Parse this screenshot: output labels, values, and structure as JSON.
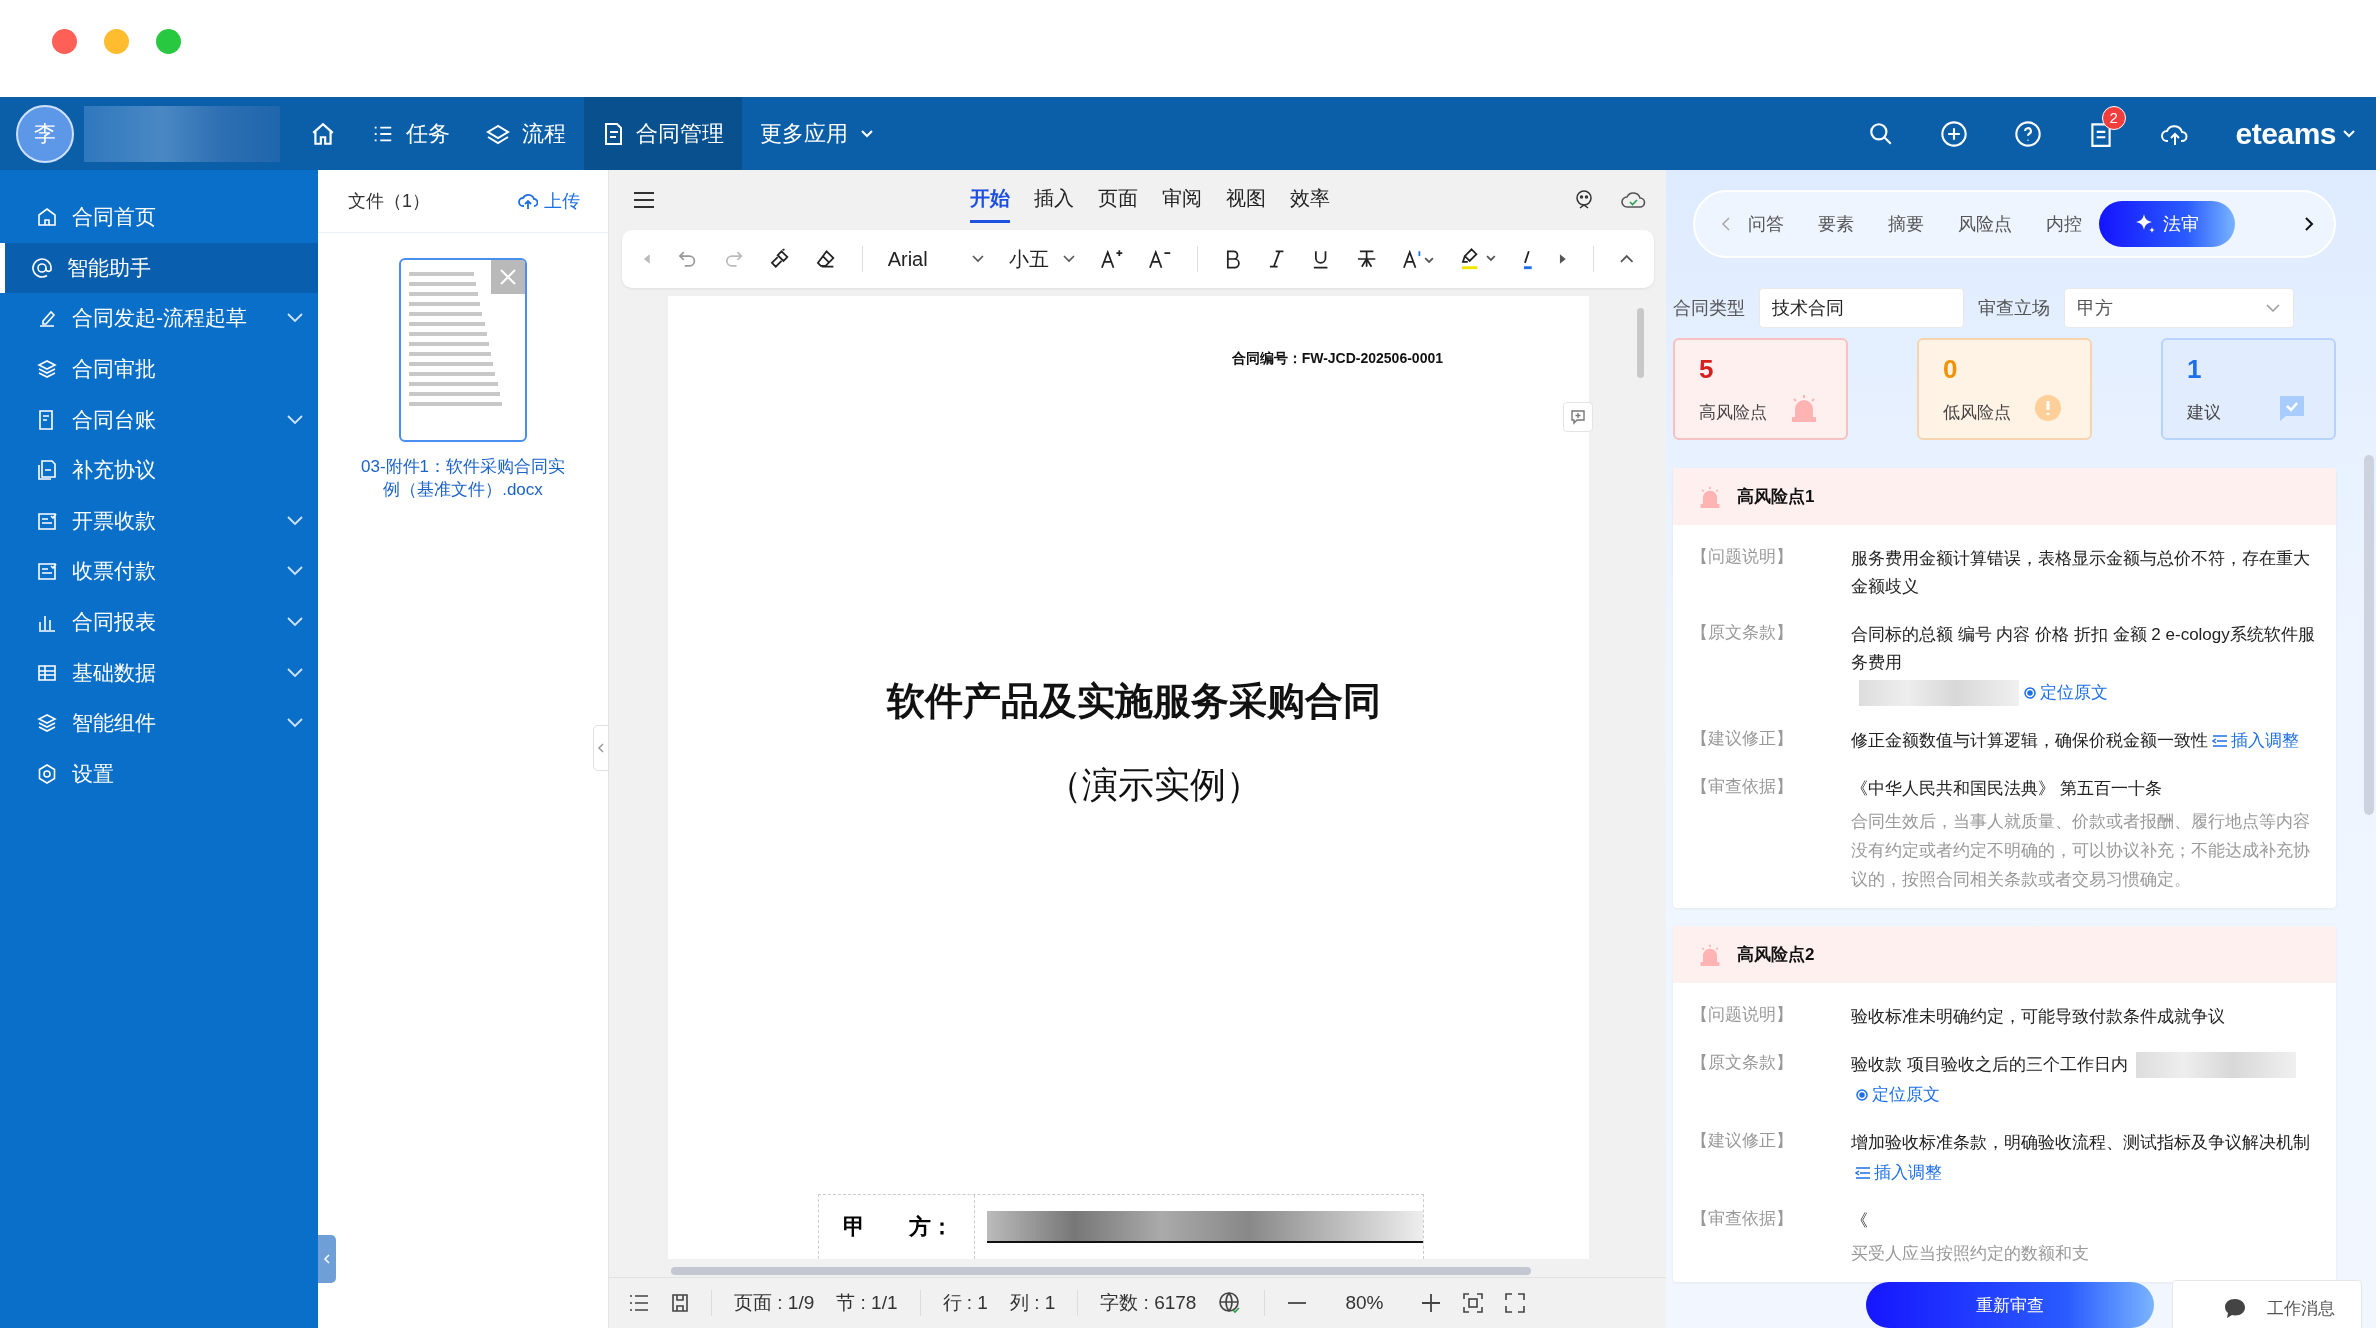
{
  "nav": {
    "avatar": "李",
    "items": [
      {
        "kind": "home",
        "selected": false
      },
      {
        "kind": "list",
        "label": "任务",
        "selected": false
      },
      {
        "kind": "layers",
        "label": "流程",
        "selected": false
      },
      {
        "kind": "doc",
        "label": "合同管理",
        "selected": true
      },
      {
        "kind": "more",
        "label": "更多应用",
        "selected": false
      }
    ],
    "badge": "2",
    "logo": "eteams"
  },
  "sidebar": {
    "items": [
      {
        "label": "合同首页",
        "group": false,
        "selected": false
      },
      {
        "label": "智能助手",
        "group": false,
        "selected": true
      },
      {
        "label": "合同发起-流程起草",
        "group": true,
        "selected": false
      },
      {
        "label": "合同审批",
        "group": false,
        "selected": false
      },
      {
        "label": "合同台账",
        "group": true,
        "selected": false
      },
      {
        "label": "补充协议",
        "group": false,
        "selected": false
      },
      {
        "label": "开票收款",
        "group": true,
        "selected": false
      },
      {
        "label": "收票付款",
        "group": true,
        "selected": false
      },
      {
        "label": "合同报表",
        "group": true,
        "selected": false
      },
      {
        "label": "基础数据",
        "group": true,
        "selected": false
      },
      {
        "label": "智能组件",
        "group": true,
        "selected": false
      },
      {
        "label": "设置",
        "group": false,
        "selected": false
      }
    ]
  },
  "files": {
    "title": "文件（1）",
    "upload": "上传",
    "items": [
      {
        "name": "03-附件1：软件采购合同实例（基准文件）.docx"
      }
    ]
  },
  "editor": {
    "tabs": [
      {
        "label": "开始",
        "selected": true
      },
      {
        "label": "插入",
        "selected": false
      },
      {
        "label": "页面",
        "selected": false
      },
      {
        "label": "审阅",
        "selected": false
      },
      {
        "label": "视图",
        "selected": false
      },
      {
        "label": "效率",
        "selected": false
      }
    ],
    "font": "Arial",
    "size": "小五",
    "document": {
      "number": "合同编号：FW-JCD-202506-0001",
      "title": "软件产品及实施服务采购合同",
      "subtitle": "（演示实例）",
      "party_label": "甲　　方："
    },
    "status": {
      "page": "页面 : 1/9",
      "section": "节 : 1/1",
      "row": "行 : 1",
      "col": "列 : 1",
      "words": "字数 : 6178",
      "zoom": "80%"
    }
  },
  "review": {
    "tabs": [
      {
        "label": "问答",
        "selected": false
      },
      {
        "label": "要素",
        "selected": false
      },
      {
        "label": "摘要",
        "selected": false
      },
      {
        "label": "风险点",
        "selected": false
      },
      {
        "label": "内控",
        "selected": false
      },
      {
        "label": "法审",
        "selected": true
      }
    ],
    "type_label": "合同类型",
    "type_value": "技术合同",
    "stance_label": "审查立场",
    "stance_value": "甲方",
    "stats": [
      {
        "kind": "high",
        "count": "5",
        "label": "高风险点"
      },
      {
        "kind": "low",
        "count": "0",
        "label": "低风险点"
      },
      {
        "kind": "suggest",
        "count": "1",
        "label": "建议"
      }
    ],
    "risks": [
      {
        "title": "高风险点1",
        "rows": [
          {
            "label": "【问题说明】",
            "text": "服务费用金额计算错误，表格显示金额与总价不符，存在重大金额歧义",
            "redacted": false
          },
          {
            "label": "【原文条款】",
            "text": "合同标的总额 编号 内容 价格 折扣 金额 2 e-cology系统软件服务费用",
            "redacted": true,
            "link": {
              "kind": "locate",
              "label": "定位原文"
            }
          },
          {
            "label": "【建议修正】",
            "text": "修正金额数值与计算逻辑，确保价税金额一致性",
            "redacted": false,
            "link": {
              "kind": "insert",
              "label": "插入调整"
            }
          },
          {
            "label": "【审查依据】",
            "text": "《中华人民共和国民法典》 第五百一十条",
            "redacted": false,
            "note": "合同生效后，当事人就质量、价款或者报酬、履行地点等内容没有约定或者约定不明确的，可以协议补充；不能达成补充协议的，按照合同相关条款或者交易习惯确定。"
          }
        ]
      },
      {
        "title": "高风险点2",
        "rows": [
          {
            "label": "【问题说明】",
            "text": "验收标准未明确约定，可能导致付款条件成就争议",
            "redacted": false
          },
          {
            "label": "【原文条款】",
            "text": "验收款 项目验收之后的三个工作日内",
            "redacted": true,
            "link": {
              "kind": "locate",
              "label": "定位原文"
            }
          },
          {
            "label": "【建议修正】",
            "text": "增加验收标准条款，明确验收流程、测试指标及争议解决机制",
            "redacted": false,
            "link": {
              "kind": "insert",
              "label": "插入调整"
            }
          },
          {
            "label": "【审查依据】",
            "text": "《",
            "redacted": false,
            "note": "买受人应当按照约定的数额和支"
          }
        ]
      }
    ],
    "recheck": "重新审查",
    "chat": "工作消息"
  }
}
